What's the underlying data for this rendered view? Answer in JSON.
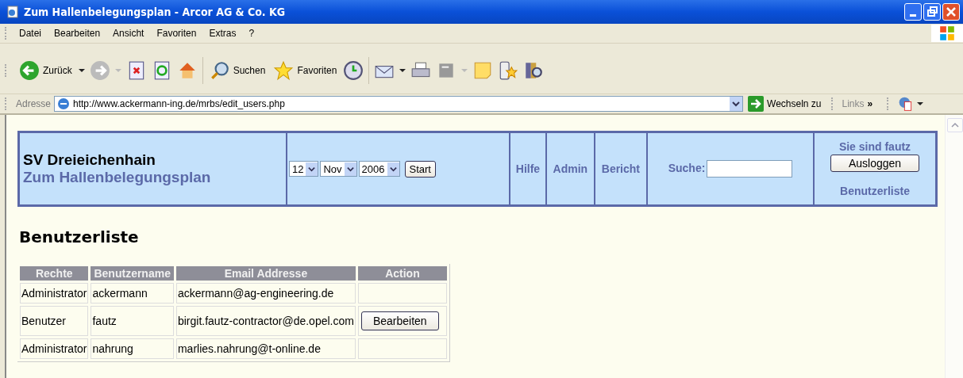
{
  "window": {
    "title": "Zum Hallenbelegungsplan - Arcor AG & Co. KG"
  },
  "menu": [
    "Datei",
    "Bearbeiten",
    "Ansicht",
    "Favoriten",
    "Extras",
    "?"
  ],
  "toolbar": {
    "back": "Zurück",
    "search": "Suchen",
    "favorites": "Favoriten"
  },
  "address_bar": {
    "label": "Adresse",
    "url": "http://www.ackermann-ing.de/mrbs/edit_users.php",
    "go": "Wechseln zu",
    "links": "Links",
    "more": "»"
  },
  "header": {
    "site": "SV Dreieichenhain",
    "subtitle": "Zum Hallenbelegungsplan",
    "date": {
      "day": "12",
      "month": "Nov",
      "year": "2006",
      "button": "Start"
    },
    "links": [
      "Hilfe",
      "Admin",
      "Bericht"
    ],
    "search": {
      "label": "Suche:"
    },
    "user": {
      "status": "Sie sind fautz",
      "logout": "Ausloggen",
      "list_link": "Benutzerliste"
    }
  },
  "page_title": "Benutzerliste",
  "table": {
    "columns": [
      "Rechte",
      "Benutzername",
      "Email Addresse",
      "Action"
    ],
    "rows": [
      {
        "rights": "Administrator",
        "username": "ackermann",
        "email": "ackermann@ag-engineering.de"
      },
      {
        "rights": "Benutzer",
        "username": "fautz",
        "email": "birgit.fautz-contractor@de.opel.com",
        "action": "Bearbeiten"
      },
      {
        "rights": "Administrator",
        "username": "nahrung",
        "email": "marlies.nahrung@t-online.de"
      }
    ]
  }
}
